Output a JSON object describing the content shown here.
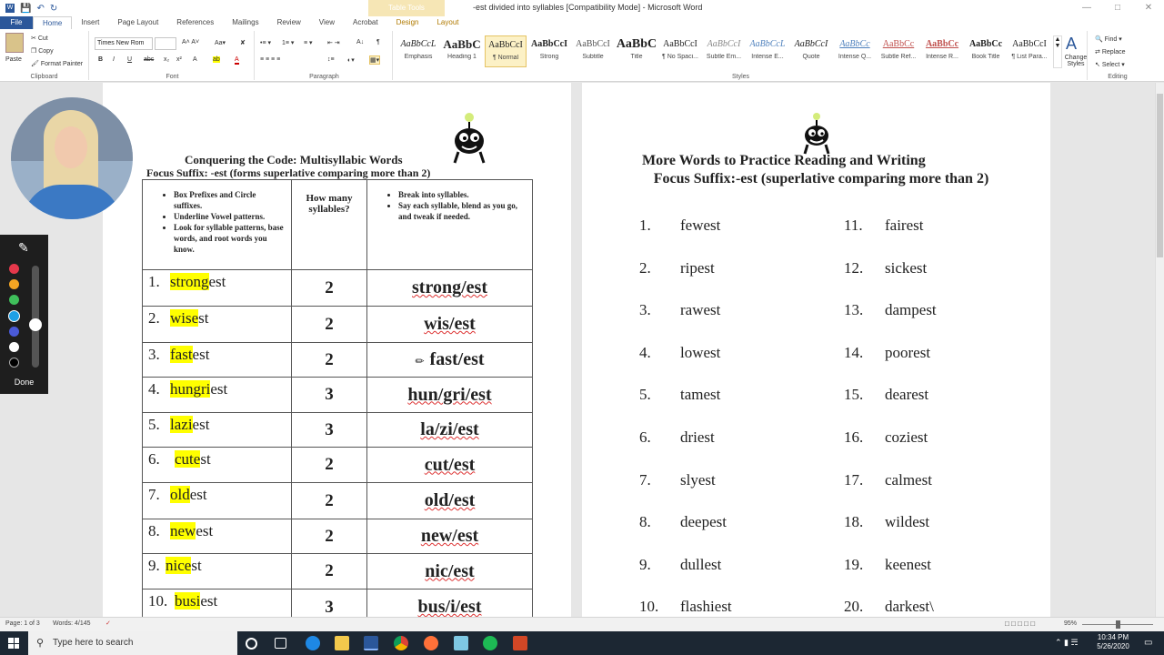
{
  "window": {
    "title": "-est divided into syllables [Compatibility Mode]  -  Microsoft Word",
    "context_tab_group": "Table Tools"
  },
  "tabs": [
    "File",
    "Home",
    "Insert",
    "Page Layout",
    "References",
    "Mailings",
    "Review",
    "View",
    "Acrobat",
    "Design",
    "Layout"
  ],
  "clipboard": {
    "paste": "Paste",
    "cut": "Cut",
    "copy": "Copy",
    "format_painter": "Format Painter",
    "group": "Clipboard"
  },
  "font": {
    "name": "Times New Rom",
    "size": "",
    "group": "Font"
  },
  "paragraph": {
    "group": "Paragraph"
  },
  "styles": {
    "group": "Styles",
    "items": [
      {
        "sample": "AaBbCcL",
        "name": "Emphasis"
      },
      {
        "sample": "AaBbC",
        "name": "Heading 1"
      },
      {
        "sample": "AaBbCcI",
        "name": "¶ Normal"
      },
      {
        "sample": "AaBbCcI",
        "name": "Strong"
      },
      {
        "sample": "AaBbCcI",
        "name": "Subtitle"
      },
      {
        "sample": "AaBbC",
        "name": "Title"
      },
      {
        "sample": "AaBbCcI",
        "name": "¶ No Spaci..."
      },
      {
        "sample": "AaBbCcI",
        "name": "Subtle Em..."
      },
      {
        "sample": "AaBbCcL",
        "name": "Intense E..."
      },
      {
        "sample": "AaBbCcI",
        "name": "Quote"
      },
      {
        "sample": "AaBbCc",
        "name": "Intense Q..."
      },
      {
        "sample": "AaBbCc",
        "name": "Subtle Ref..."
      },
      {
        "sample": "AaBbCc",
        "name": "Intense R..."
      },
      {
        "sample": "AaBbCc",
        "name": "Book Title"
      },
      {
        "sample": "AaBbCcI",
        "name": "¶ List Para..."
      }
    ],
    "change_styles": "Change Styles"
  },
  "editing": {
    "find": "Find",
    "replace": "Replace",
    "select": "Select",
    "group": "Editing"
  },
  "pen_toolbar": {
    "done": "Done"
  },
  "left_page": {
    "title": "Conquering the Code: Multisyllabic Words",
    "subtitle": "Focus Suffix: -est (forms superlative comparing more than 2)",
    "header_col1": [
      "Box Prefixes and Circle suffixes.",
      "Underline Vowel patterns.",
      "Look for syllable patterns, base words, and root words you know."
    ],
    "header_col2": "How many syllables?",
    "header_col3": [
      "Break into syllables.",
      "Say each syllable, blend as you go, and tweak if needed."
    ],
    "rows": [
      {
        "num": "1.",
        "hl": "strong",
        "rest": "est",
        "count": "2",
        "split": "strong/est"
      },
      {
        "num": "2.",
        "hl": "wise",
        "rest": "st",
        "count": "2",
        "split": "wis/est"
      },
      {
        "num": "3.",
        "hl": "fast",
        "rest": "est",
        "count": "2",
        "split": "fast/est"
      },
      {
        "num": "4.",
        "hl": "hungri",
        "rest": "est",
        "count": "3",
        "split": "hun/gri/est"
      },
      {
        "num": "5.",
        "hl": "lazi",
        "rest": "est",
        "count": "3",
        "split": "la/zi/est"
      },
      {
        "num": "6.",
        "hl": "cute",
        "rest": "st",
        "count": "2",
        "split": "cut/est"
      },
      {
        "num": "7.",
        "hl": "old",
        "rest": "est",
        "count": "2",
        "split": "old/est"
      },
      {
        "num": "8.",
        "hl": "new",
        "rest": "est",
        "count": "2",
        "split": "new/est"
      },
      {
        "num": "9.",
        "hl": "nice",
        "rest": "st",
        "count": "2",
        "split": "nic/est"
      },
      {
        "num": "10.",
        "hl": "busi",
        "rest": "est",
        "count": "3",
        "split": "bus/i/est"
      }
    ]
  },
  "right_page": {
    "title": "More Words to Practice Reading and Writing",
    "subtitle": "Focus Suffix:-est (superlative comparing more than 2)",
    "col1": [
      {
        "num": "1.",
        "word": "fewest"
      },
      {
        "num": "2.",
        "word": "ripest"
      },
      {
        "num": "3.",
        "word": "rawest"
      },
      {
        "num": "4.",
        "word": "lowest"
      },
      {
        "num": "5.",
        "word": "tamest"
      },
      {
        "num": "6.",
        "word": "driest"
      },
      {
        "num": "7.",
        "word": "slyest"
      },
      {
        "num": "8.",
        "word": "deepest"
      },
      {
        "num": "9.",
        "word": "dullest"
      },
      {
        "num": "10.",
        "word": "flashiest"
      }
    ],
    "col2": [
      {
        "num": "11.",
        "word": "fairest"
      },
      {
        "num": "12.",
        "word": "sickest"
      },
      {
        "num": "13.",
        "word": "dampest"
      },
      {
        "num": "14.",
        "word": "poorest"
      },
      {
        "num": "15.",
        "word": "dearest"
      },
      {
        "num": "16.",
        "word": "coziest"
      },
      {
        "num": "17.",
        "word": "calmest"
      },
      {
        "num": "18.",
        "word": "wildest"
      },
      {
        "num": "19.",
        "word": "keenest"
      },
      {
        "num": "20.",
        "word": "darkest\\"
      }
    ]
  },
  "status": {
    "page": "Page: 1 of 3",
    "words": "Words: 4/145",
    "zoom": "95%"
  },
  "taskbar": {
    "search_placeholder": "Type here to search",
    "time": "10:34 PM",
    "date": "5/26/2020"
  }
}
